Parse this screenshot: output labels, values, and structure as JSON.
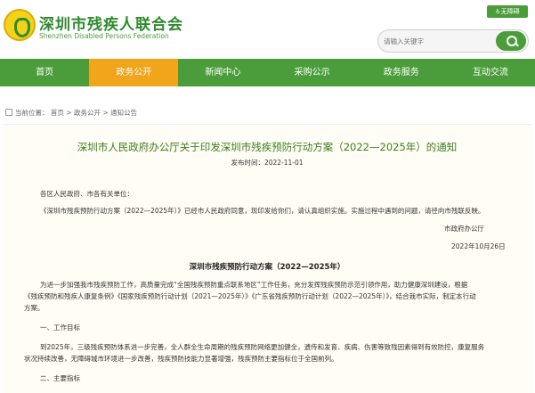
{
  "header": {
    "org_name_cn": "深圳市残疾人联合会",
    "org_name_en": "Shenzhen Disabled Persons Federation",
    "accessibility_label": "无障碍",
    "search_placeholder": "请输入关键字",
    "logo_icon": "disability-federation-logo-icon"
  },
  "nav": {
    "items": [
      {
        "label": "首页"
      },
      {
        "label": "政务公开"
      },
      {
        "label": "新闻中心"
      },
      {
        "label": "采购公示"
      },
      {
        "label": "政务服务"
      },
      {
        "label": "互动交流"
      }
    ],
    "active_index": 1
  },
  "breadcrumb": {
    "prefix": "当前位置：",
    "items": [
      "首页",
      "政务公开",
      "通知公告"
    ],
    "separator": ">"
  },
  "article": {
    "title": "深圳市人民政府办公厅关于印发深圳市残疾预防行动方案（2022—2025年）的通知",
    "publish_label": "发布时间：",
    "publish_date": "2022-11-01",
    "salutation": "各区人民政府、市各有关单位：",
    "notice_body": "《深圳市残疾预防行动方案（2022—2025年）》已经市人民政府同意，现印发给你们，请认真组织实施。实施过程中遇到的问题，请径向市残联反映。",
    "issuer": "市政府办公厅",
    "issue_date": "2022年10月26日",
    "plan_title": "深圳市残疾预防行动方案（2022—2025年）",
    "intro_line1": "为进一步加强我市残疾预防工作，高质量完成“全国残疾预防重点联系地区”工作任务，充分发挥残疾预防示范引领作用，助力健康深圳建设，根据",
    "intro_line2": "《残疾预防和残疾人康复条例》《国家残疾预防行动计划（2021—2025年）》《广东省残疾预防行动计划（2022—2025年）》，结合我市实际，制定本行动",
    "intro_line3": "方案。",
    "section1_heading": "一、工作目标",
    "goal_line1": "到2025年，三级残疾预防体系进一步完善，全人群全生命周期的残疾预防网络更加健全，遗传和发育、疾病、伤害等致残因素得到有效防控，康复服务",
    "goal_line2": "状况持续改善，无障碍城市环境进一步改善，残疾预防技能力显著增强，残疾预防主要指标位于全国前列。",
    "section2_heading": "二、主要指标"
  },
  "colors": {
    "brand_green": "#4b9d3b",
    "nav_active_orange": "#f0a51b",
    "title_green": "#3d7f1f"
  }
}
